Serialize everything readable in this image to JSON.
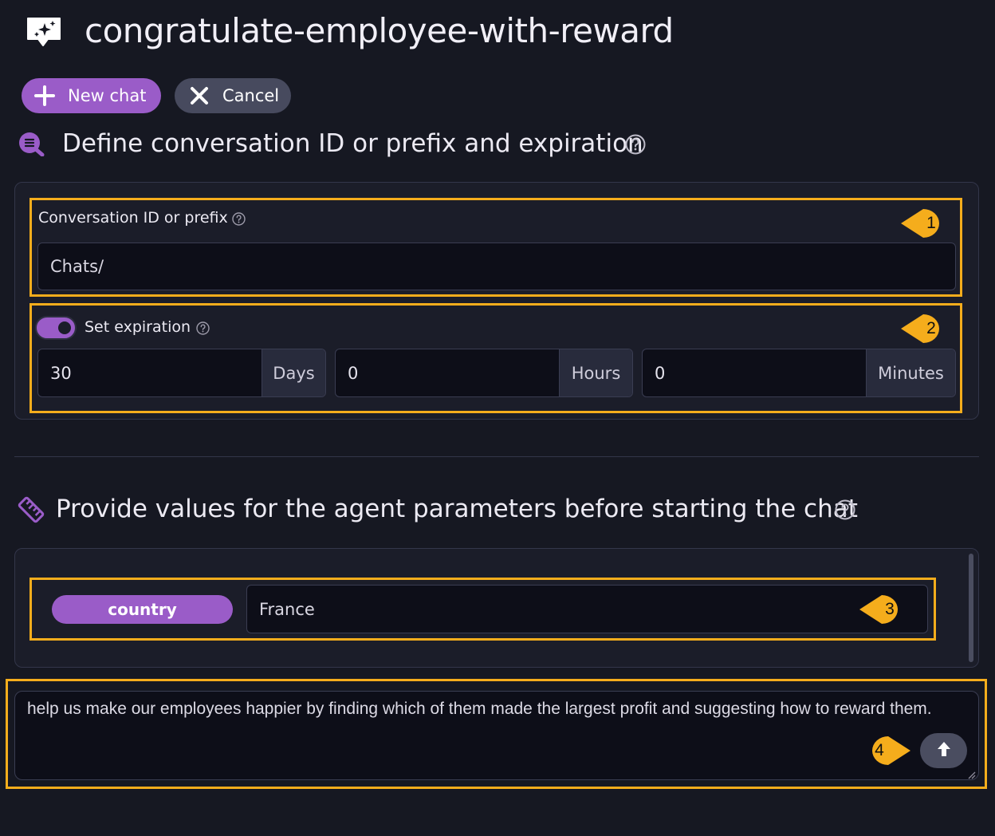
{
  "header": {
    "title": "congratulate-employee-with-reward",
    "icon": "chat-sparkle-icon"
  },
  "toolbar": {
    "new_chat_label": "New chat",
    "cancel_label": "Cancel"
  },
  "conversation_section": {
    "title": "Define conversation ID or prefix and expiration",
    "id_label": "Conversation ID or prefix",
    "id_value": "Chats/",
    "expiration_label": "Set expiration",
    "expiration_enabled": true,
    "days_value": "30",
    "days_unit": "Days",
    "hours_value": "0",
    "hours_unit": "Hours",
    "minutes_value": "0",
    "minutes_unit": "Minutes"
  },
  "parameters_section": {
    "title": "Provide values for the agent parameters before starting the chat",
    "params": [
      {
        "name": "country",
        "value": "France"
      }
    ]
  },
  "chat_input": {
    "text": "help us make our employees happier by finding which of them made the largest profit and suggesting how to reward them."
  },
  "markers": [
    "1",
    "2",
    "3",
    "4"
  ],
  "colors": {
    "background": "#161822",
    "accent": "#9a5cc8",
    "highlight": "#f5ad1c",
    "marker": "#f5ad1c"
  }
}
